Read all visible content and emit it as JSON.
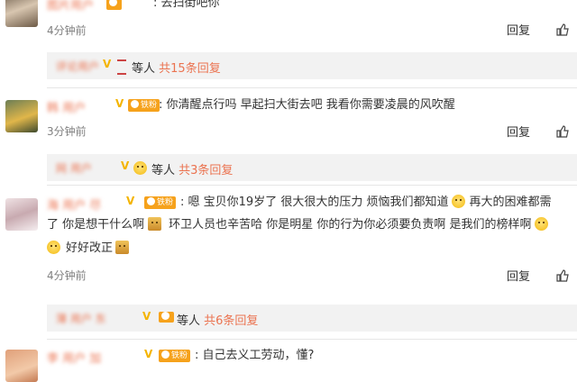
{
  "comments": [
    {
      "username": "图片用户",
      "text": "去扫街吧你",
      "time": "4分钟前",
      "reply_label": "回复",
      "sub": {
        "name": "评论用户",
        "text": "等人",
        "more": "共15条回复"
      }
    },
    {
      "username": "韩 用户",
      "text": "你清醒点行吗 早起扫大街去吧 我看你需要凌晨的风吹醒",
      "time": "3分钟前",
      "reply_label": "回复",
      "sub": {
        "name": "网 用户",
        "text": "等人",
        "more": "共3条回复"
      }
    },
    {
      "username": "海 用户 尽",
      "text_parts": [
        "嗯 宝贝你19岁了 很大很大的压力 烦恼我们都知道",
        "再大的困难都需",
        "了 你是想干什么啊",
        "环卫人员也辛苦哈 你是明星 你的行为你必须要负责啊 是我们的榜样啊",
        "好好改正"
      ],
      "time": "4分钟前",
      "reply_label": "回复",
      "sub": {
        "name": "薄 用户 东",
        "text": "等人",
        "more": "共6条回复"
      }
    },
    {
      "username": "李 用户 加",
      "text": "自己去义工劳动，懂?",
      "time": "",
      "reply_label": ""
    }
  ],
  "icons": {
    "vip": "crown-icon",
    "fan": "fan-badge-icon",
    "like": "thumbs-up-icon",
    "emoji": "smiley-emoji-icon"
  },
  "colors": {
    "username": "#eb7350",
    "badge": "#f6a21c",
    "sub_bg": "#f2f2f2",
    "vip": "#f4b400"
  }
}
